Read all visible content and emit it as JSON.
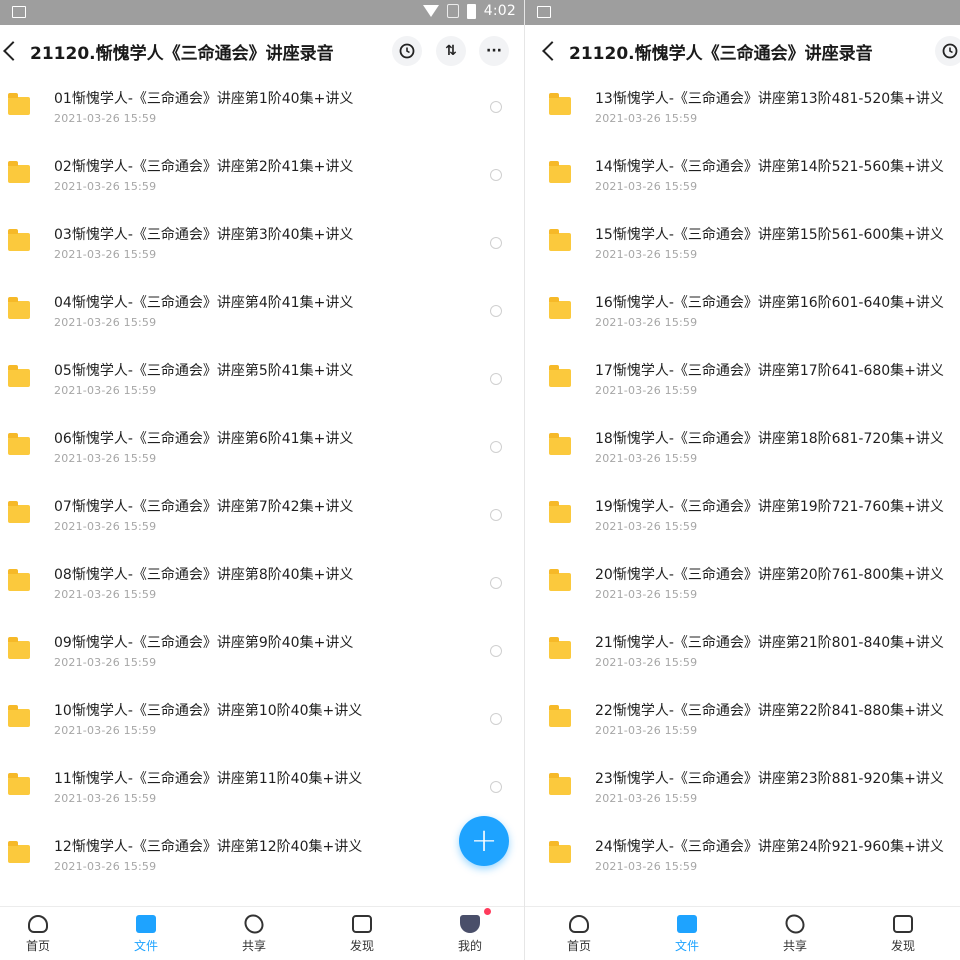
{
  "status_bar": {
    "time": "4:02"
  },
  "header": {
    "title": "21120.惭愧学人《三命通会》讲座录音",
    "sort_label": "⇅",
    "more_label": "···"
  },
  "left_list": [
    {
      "name": "01惭愧学人-《三命通会》讲座第1阶40集+讲义",
      "date": "2021-03-26  15:59"
    },
    {
      "name": "02惭愧学人-《三命通会》讲座第2阶41集+讲义",
      "date": "2021-03-26  15:59"
    },
    {
      "name": "03惭愧学人-《三命通会》讲座第3阶40集+讲义",
      "date": "2021-03-26  15:59"
    },
    {
      "name": "04惭愧学人-《三命通会》讲座第4阶41集+讲义",
      "date": "2021-03-26  15:59"
    },
    {
      "name": "05惭愧学人-《三命通会》讲座第5阶41集+讲义",
      "date": "2021-03-26  15:59"
    },
    {
      "name": "06惭愧学人-《三命通会》讲座第6阶41集+讲义",
      "date": "2021-03-26  15:59"
    },
    {
      "name": "07惭愧学人-《三命通会》讲座第7阶42集+讲义",
      "date": "2021-03-26  15:59"
    },
    {
      "name": "08惭愧学人-《三命通会》讲座第8阶40集+讲义",
      "date": "2021-03-26  15:59"
    },
    {
      "name": "09惭愧学人-《三命通会》讲座第9阶40集+讲义",
      "date": "2021-03-26  15:59"
    },
    {
      "name": "10惭愧学人-《三命通会》讲座第10阶40集+讲义",
      "date": "2021-03-26  15:59"
    },
    {
      "name": "11惭愧学人-《三命通会》讲座第11阶40集+讲义",
      "date": "2021-03-26  15:59"
    },
    {
      "name": "12惭愧学人-《三命通会》讲座第12阶40集+讲义",
      "date": "2021-03-26  15:59"
    }
  ],
  "right_list": [
    {
      "name": "13惭愧学人-《三命通会》讲座第13阶481-520集+讲义",
      "date": "2021-03-26  15:59"
    },
    {
      "name": "14惭愧学人-《三命通会》讲座第14阶521-560集+讲义",
      "date": "2021-03-26  15:59"
    },
    {
      "name": "15惭愧学人-《三命通会》讲座第15阶561-600集+讲义",
      "date": "2021-03-26  15:59"
    },
    {
      "name": "16惭愧学人-《三命通会》讲座第16阶601-640集+讲义",
      "date": "2021-03-26  15:59"
    },
    {
      "name": "17惭愧学人-《三命通会》讲座第17阶641-680集+讲义",
      "date": "2021-03-26  15:59"
    },
    {
      "name": "18惭愧学人-《三命通会》讲座第18阶681-720集+讲义",
      "date": "2021-03-26  15:59"
    },
    {
      "name": "19惭愧学人-《三命通会》讲座第19阶721-760集+讲义",
      "date": "2021-03-26  15:59"
    },
    {
      "name": "20惭愧学人-《三命通会》讲座第20阶761-800集+讲义",
      "date": "2021-03-26  15:59"
    },
    {
      "name": "21惭愧学人-《三命通会》讲座第21阶801-840集+讲义",
      "date": "2021-03-26  15:59"
    },
    {
      "name": "22惭愧学人-《三命通会》讲座第22阶841-880集+讲义",
      "date": "2021-03-26  15:59"
    },
    {
      "name": "23惭愧学人-《三命通会》讲座第23阶881-920集+讲义",
      "date": "2021-03-26  15:59"
    },
    {
      "name": "24惭愧学人-《三命通会》讲座第24阶921-960集+讲义",
      "date": "2021-03-26  15:59"
    }
  ],
  "fab_label": "+",
  "tabs_left": [
    {
      "label": "首页",
      "icon": "home-icon"
    },
    {
      "label": "文件",
      "icon": "files-icon"
    },
    {
      "label": "共享",
      "icon": "share-icon"
    },
    {
      "label": "发现",
      "icon": "discover-icon"
    },
    {
      "label": "我的",
      "icon": "me-icon"
    }
  ],
  "tabs_right": [
    {
      "label": "首页",
      "icon": "home-icon"
    },
    {
      "label": "文件",
      "icon": "files-icon"
    },
    {
      "label": "共享",
      "icon": "share-icon"
    },
    {
      "label": "发现",
      "icon": "discover-icon"
    }
  ],
  "colors": {
    "accent": "#1ea3ff",
    "folder": "#fbc93d",
    "badge": "#ff3b5c"
  }
}
